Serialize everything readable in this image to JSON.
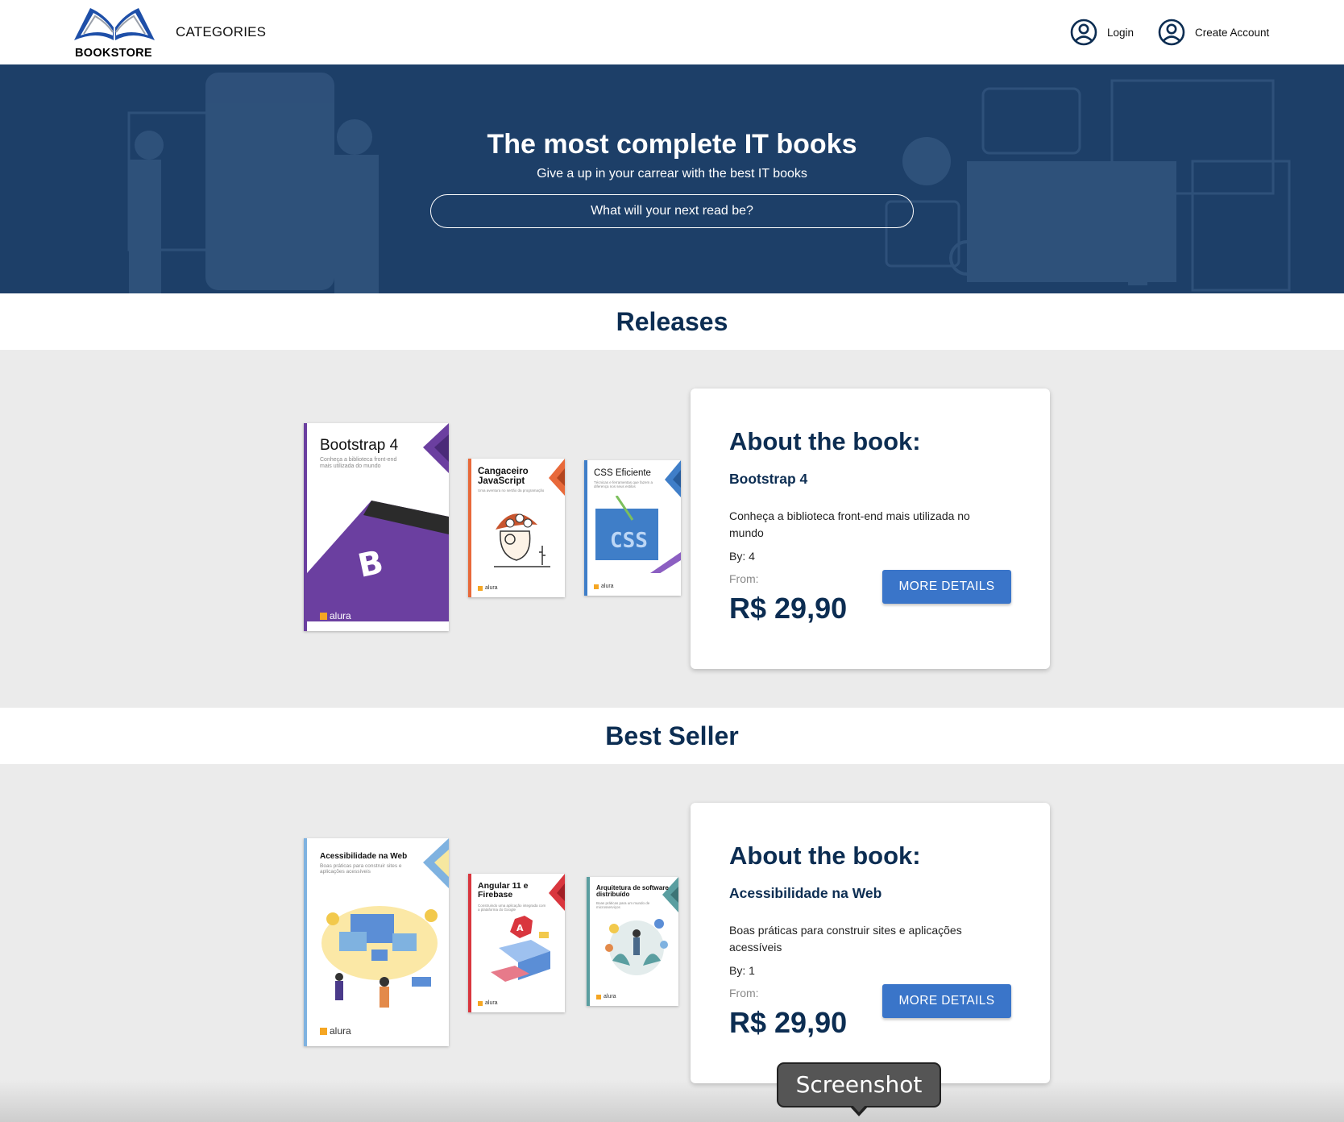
{
  "header": {
    "logo_text": "BOOKSTORE",
    "categories": "CATEGORIES",
    "login": "Login",
    "create_account": "Create Account"
  },
  "hero": {
    "title": "The most complete IT books",
    "subtitle": "Give a up in your carrear with the best IT books",
    "search_placeholder": "What will your next read be?"
  },
  "releases": {
    "heading": "Releases",
    "books": [
      {
        "title": "Bootstrap 4",
        "subtitle": "Conheça a biblioteca front-end mais utilizada do mundo",
        "color": "#6b3fa0"
      },
      {
        "title": "Cangaceiro JavaScript",
        "subtitle": "Uma aventura no sertão da programação",
        "color": "#e8693a"
      },
      {
        "title": "CSS Eficiente",
        "subtitle": "Técnicas e ferramentas que fazem a diferença nos seus estilos",
        "color": "#3f7ec8"
      }
    ],
    "card": {
      "heading": "About the book:",
      "title": "Bootstrap 4",
      "description": "Conheça a biblioteca front-end mais utilizada no mundo",
      "by": "By: 4",
      "from": "From:",
      "price": "R$ 29,90",
      "button": "MORE DETAILS"
    }
  },
  "best_seller": {
    "heading": "Best Seller",
    "books": [
      {
        "title": "Acessibilidade na Web",
        "subtitle": "Boas práticas para construir sites e aplicações acessíveis",
        "color": "#7fb2e0"
      },
      {
        "title": "Angular 11 e Firebase",
        "subtitle": "Construindo uma aplicação integrada com a plataforma do Google",
        "color": "#d9363e"
      },
      {
        "title": "Arquitetura de software distribuído",
        "subtitle": "Boas práticas para um mundo de microsserviços",
        "color": "#5a9ea0"
      }
    ],
    "card": {
      "heading": "About the book:",
      "title": "Acessibilidade na Web",
      "description": "Boas práticas para construir sites e aplicações acessíveis",
      "by": "By: 1",
      "from": "From:",
      "price": "R$ 29,90",
      "button": "MORE DETAILS"
    }
  },
  "book_publisher": "alura",
  "tooltip": "Screenshot",
  "colors": {
    "navy": "#0c2d52",
    "hero_bg": "#1d3f68",
    "button_blue": "#3a75c9",
    "section_bg": "#ebebeb"
  }
}
